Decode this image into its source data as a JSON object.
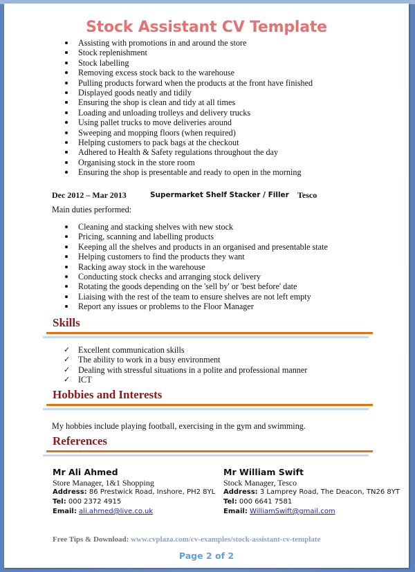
{
  "document": {
    "title": "Stock Assistant CV Template",
    "previous_duties": [
      "Assisting with promotions in and around the store",
      "Stock replenishment",
      "Stock labelling",
      "Removing excess stock back to the warehouse",
      "Pulling products forward when the products at the front have finished",
      "Displayed goods neatly and tidily",
      "Ensuring the shop is clean and tidy at all times",
      "Loading and unloading trolleys  and delivery trucks",
      "Using pallet trucks to move deliveries around",
      "Sweeping and mopping floors (when required)",
      "Helping customers to pack bags at the checkout",
      "Adhered to Health & Safety regulations throughout the day",
      "Organising stock in the store room",
      "Ensuring the shop is presentable and ready to open in the morning"
    ],
    "job": {
      "dates": "Dec 2012 – Mar 2013",
      "title": "Supermarket Shelf Stacker / Filler",
      "company": "Tesco",
      "duties_label": "Main duties performed:",
      "duties": [
        "Cleaning and stacking shelves with new stock",
        "Pricing, scanning and labelling products",
        "Keeping all the shelves and products in an organised and presentable state",
        "Helping customers to find the products they want",
        "Racking away stock in the warehouse",
        "Conducting stock checks and arranging  stock delivery",
        "Rotating the goods depending on the 'sell by' or 'best before' date",
        "Liaising with the rest of the team to ensure shelves are not left empty",
        "Report any issues or problems to the Floor Manager"
      ]
    },
    "skills": {
      "heading": "Skills",
      "items": [
        "Excellent communication  skills",
        "The ability to work in a busy environment",
        "Dealing with stressful situations in a polite and professional manner",
        "ICT"
      ]
    },
    "hobbies": {
      "heading": "Hobbies and Interests",
      "text": "My hobbies include playing football, exercising in the gym and swimming."
    },
    "references": {
      "heading": "References",
      "address_label": "Address:",
      "tel_label": "Tel:",
      "email_label": "Email:",
      "items": [
        {
          "name": "Mr Ali Ahmed",
          "role": "Store Manager, 1&1 Shopping",
          "address": "86 Prestwick Road, Inshore, PH2 8YL",
          "tel": "000 2372 4915",
          "email": "ali.ahmed@live.co.uk"
        },
        {
          "name": "Mr William Swift",
          "role": "Stock Manager, Tesco",
          "address": "3 Lamprey Road, The Deacon, TN26 8YT",
          "tel": "000 6641 7581",
          "email": "WilliamSwift@gmail.com"
        }
      ]
    },
    "footer": {
      "tips_label": "Free Tips & Download:",
      "tips_url": "www.cvplaza.com/cv-examples/stock-assistant-cv-template",
      "page_number": "Page 2 of 2"
    }
  },
  "colors": {
    "title": "#e07474",
    "heading": "#8b1a1a",
    "rule_orange": "#e8700e",
    "rule_blue": "#c8d9ee",
    "link": "#1a1acc",
    "page_number": "#5f9fe0",
    "background": "#5b82bd"
  }
}
